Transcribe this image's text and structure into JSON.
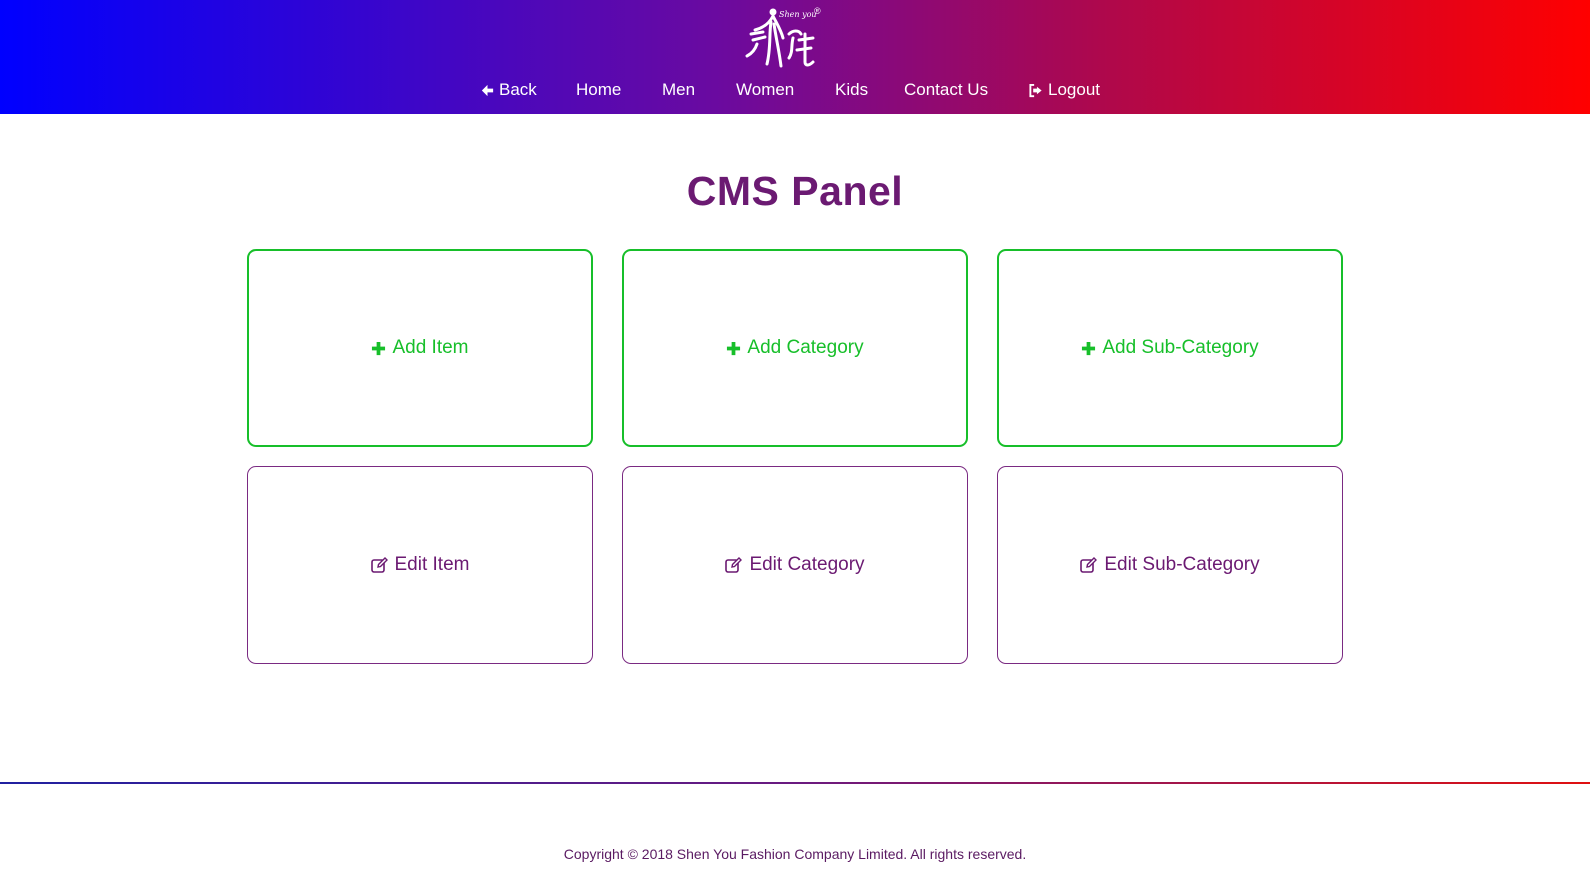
{
  "header": {
    "logo": {
      "tagline": "Shen you",
      "registered_mark": "®",
      "icon": "shenyou-logo-icon"
    },
    "nav": [
      {
        "label": "Back",
        "icon": "arrow-left-icon"
      },
      {
        "label": "Home"
      },
      {
        "label": "Men"
      },
      {
        "label": "Women"
      },
      {
        "label": "Kids"
      },
      {
        "label": "Contact Us"
      },
      {
        "label": "Logout",
        "icon": "sign-out-icon"
      }
    ]
  },
  "main": {
    "title": "CMS Panel",
    "cards": [
      {
        "label": "Add Item",
        "icon": "plus-icon"
      },
      {
        "label": "Add Category",
        "icon": "plus-icon"
      },
      {
        "label": "Add Sub-Category",
        "icon": "plus-icon"
      },
      {
        "label": "Edit Item",
        "icon": "edit-icon"
      },
      {
        "label": "Edit Category",
        "icon": "edit-icon"
      },
      {
        "label": "Edit Sub-Category",
        "icon": "edit-icon"
      }
    ]
  },
  "footer": {
    "copyright": "Copyright © 2018 Shen You Fashion Company Limited. All rights reserved."
  },
  "colors": {
    "header_gradient_start": "#0000ff",
    "header_gradient_end": "#ff0000",
    "title": "#6b1a72",
    "add_accent": "#17bf2a",
    "edit_accent": "#7a2a82"
  }
}
